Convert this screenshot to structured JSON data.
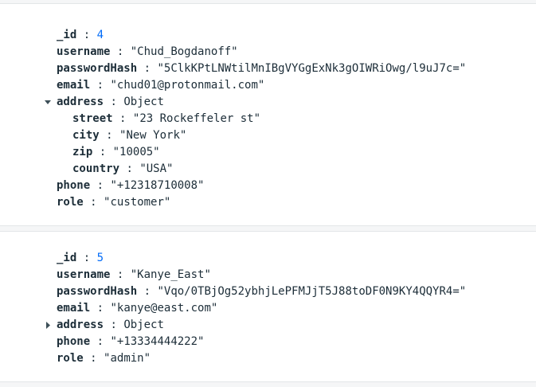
{
  "documents": [
    {
      "id_key": "_id",
      "id_value": "4",
      "fields": {
        "username": {
          "key": "username",
          "value": "\"Chud_Bogdanoff\""
        },
        "passwordHash": {
          "key": "passwordHash",
          "value": "\"5ClkKPtLNWtilMnIBgVYGgExNk3gOIWRiOwg/l9uJ7c=\""
        },
        "email": {
          "key": "email",
          "value": "\"chud01@protonmail.com\""
        },
        "address": {
          "key": "address",
          "value": "Object",
          "expanded": true
        },
        "street": {
          "key": "street",
          "value": "\"23 Rockeffeler st\""
        },
        "city": {
          "key": "city",
          "value": "\"New York\""
        },
        "zip": {
          "key": "zip",
          "value": "\"10005\""
        },
        "country": {
          "key": "country",
          "value": "\"USA\""
        },
        "phone": {
          "key": "phone",
          "value": "\"+12318710008\""
        },
        "role": {
          "key": "role",
          "value": "\"customer\""
        }
      }
    },
    {
      "id_key": "_id",
      "id_value": "5",
      "fields": {
        "username": {
          "key": "username",
          "value": "\"Kanye_East\""
        },
        "passwordHash": {
          "key": "passwordHash",
          "value": "\"Vqo/0TBjOg52ybhjLePFMJjT5J88toDF0N9KY4QQYR4=\""
        },
        "email": {
          "key": "email",
          "value": "\"kanye@east.com\""
        },
        "address": {
          "key": "address",
          "value": "Object",
          "expanded": false
        },
        "phone": {
          "key": "phone",
          "value": "\"+13334444222\""
        },
        "role": {
          "key": "role",
          "value": "\"admin\""
        }
      }
    }
  ],
  "separator": ":",
  "icons": {
    "expanded": "caret-down-icon",
    "collapsed": "caret-right-icon"
  }
}
